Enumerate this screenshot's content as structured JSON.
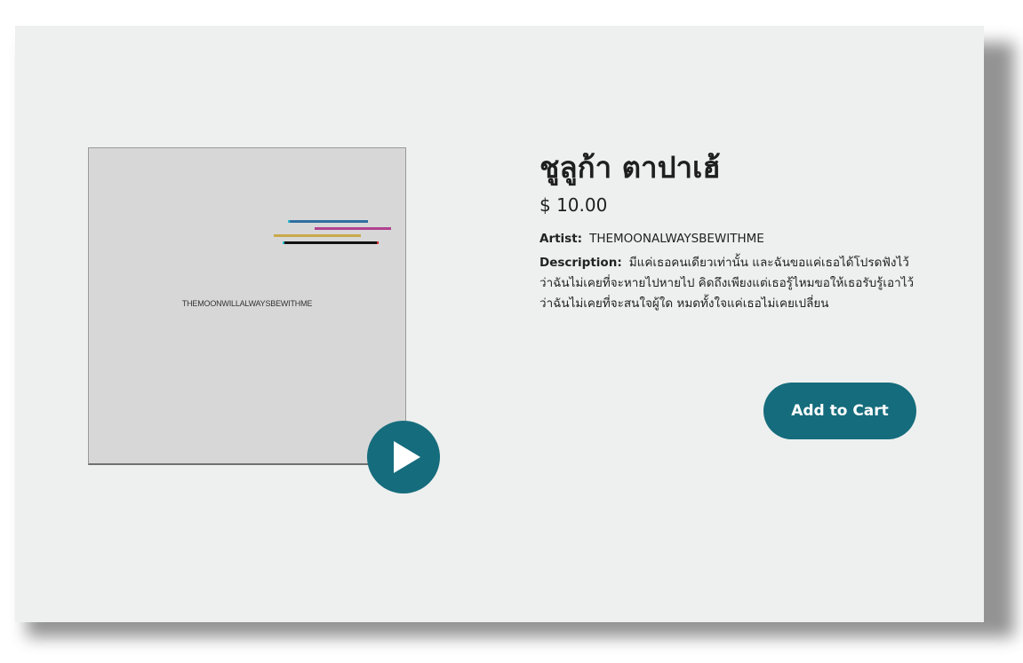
{
  "product": {
    "title": "ชูลูก้า ตาปาเฮ้",
    "price": "$ 10.00",
    "artist_label": "Artist:",
    "artist": "THEMOONALWAYSBEWITHME",
    "description_label": "Description:",
    "description": "มีแค่เธอคนเดียวเท่านั้น และฉันขอแค่เธอได้โปรดฟังไว้ ว่าฉันไม่เคยที่จะหายไปหายไป คิดถึงเพียงแต่เธอรู้ไหมขอให้เธอรับรู้เอาไว้ ว่าฉันไม่เคยที่จะสนใจผู้ใด หมดทั้งใจแค่เธอไม่เคยเปลี่ยน"
  },
  "cover": {
    "text": "THEMOONWILLALWAYSBEWITHME",
    "stripe_colors": [
      "#2f6fa0",
      "#b0418f",
      "#c9a94a",
      "#111111"
    ]
  },
  "buttons": {
    "add_to_cart": "Add to Cart",
    "play_icon": "play-icon"
  },
  "colors": {
    "accent": "#156c7c",
    "card_background": "#edf0ef",
    "cover_background": "#d7d7d7"
  }
}
